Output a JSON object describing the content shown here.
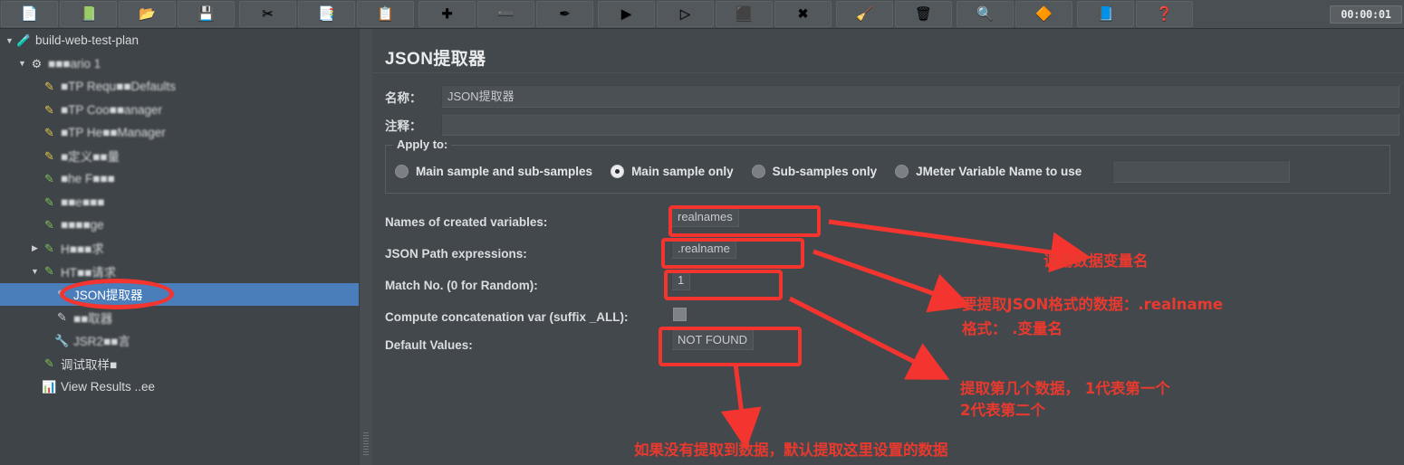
{
  "toolbar": {
    "buttons": [
      {
        "name": "new",
        "glyph": "📄"
      },
      {
        "name": "templates",
        "glyph": "📗"
      },
      {
        "name": "open",
        "glyph": "📂"
      },
      {
        "name": "save",
        "glyph": "💾"
      },
      {
        "name": "cut",
        "glyph": "✂"
      },
      {
        "name": "copy",
        "glyph": "📑"
      },
      {
        "name": "paste",
        "glyph": "📋"
      },
      {
        "name": "expand-all",
        "glyph": "✚"
      },
      {
        "name": "collapse-all",
        "glyph": "➖"
      },
      {
        "name": "toggle",
        "glyph": "✒"
      },
      {
        "name": "start",
        "glyph": "▶"
      },
      {
        "name": "start-no-timers",
        "glyph": "▷"
      },
      {
        "name": "stop",
        "glyph": "⬛"
      },
      {
        "name": "shutdown",
        "glyph": "✖"
      },
      {
        "name": "clear",
        "glyph": "🧹"
      },
      {
        "name": "clear-all",
        "glyph": "🗑"
      },
      {
        "name": "search",
        "glyph": "🔍"
      },
      {
        "name": "search-reset",
        "glyph": "🔶"
      },
      {
        "name": "function-helper",
        "glyph": "📘"
      },
      {
        "name": "help",
        "glyph": "❓"
      }
    ],
    "clock": "00:00:01"
  },
  "tree": {
    "items": [
      {
        "label": "build-web-test-plan",
        "indent": 0,
        "toggle": "▼",
        "icon": "🧪",
        "icon_color": "#5aa6e8",
        "selected": false,
        "blur": false
      },
      {
        "label": "■■■ario 1",
        "indent": 1,
        "toggle": "▼",
        "icon": "⚙",
        "icon_color": "#d8dbdd",
        "selected": false,
        "blur": true
      },
      {
        "label": "■TP Requ■■Defaults",
        "indent": 2,
        "toggle": "",
        "icon": "✎",
        "icon_color": "#e0c84a",
        "selected": false,
        "blur": true
      },
      {
        "label": "■TP Coo■■anager",
        "indent": 2,
        "toggle": "",
        "icon": "✎",
        "icon_color": "#e0c84a",
        "selected": false,
        "blur": true
      },
      {
        "label": "■TP He■■Manager",
        "indent": 2,
        "toggle": "",
        "icon": "✎",
        "icon_color": "#e0c84a",
        "selected": false,
        "blur": true
      },
      {
        "label": "■定义■■量",
        "indent": 2,
        "toggle": "",
        "icon": "✎",
        "icon_color": "#e0c84a",
        "selected": false,
        "blur": true
      },
      {
        "label": "■he F■■■",
        "indent": 2,
        "toggle": "",
        "icon": "✎",
        "icon_color": "#7dc15a",
        "selected": false,
        "blur": true
      },
      {
        "label": "■■e■■■",
        "indent": 2,
        "toggle": "",
        "icon": "✎",
        "icon_color": "#7dc15a",
        "selected": false,
        "blur": true
      },
      {
        "label": "■■■■ge",
        "indent": 2,
        "toggle": "",
        "icon": "✎",
        "icon_color": "#7dc15a",
        "selected": false,
        "blur": true
      },
      {
        "label": "H■■■求",
        "indent": 2,
        "toggle": "▶",
        "icon": "✎",
        "icon_color": "#7dc15a",
        "selected": false,
        "blur": true
      },
      {
        "label": "HT■■请求",
        "indent": 2,
        "toggle": "▼",
        "icon": "✎",
        "icon_color": "#7dc15a",
        "selected": false,
        "blur": true
      },
      {
        "label": "JSON提取器",
        "indent": 3,
        "toggle": "",
        "icon": "✎",
        "icon_color": "#c9ccd0",
        "selected": true,
        "blur": false
      },
      {
        "label": "■■取器",
        "indent": 3,
        "toggle": "",
        "icon": "✎",
        "icon_color": "#c9ccd0",
        "selected": false,
        "blur": true
      },
      {
        "label": "JSR2■■言",
        "indent": 3,
        "toggle": "",
        "icon": "🔧",
        "icon_color": "#9fc9e8",
        "selected": false,
        "blur": true
      },
      {
        "label": "调试取样■",
        "indent": 2,
        "toggle": "",
        "icon": "✎",
        "icon_color": "#7dc15a",
        "selected": false,
        "blur": false
      },
      {
        "label": "View Results ..ee",
        "indent": 2,
        "toggle": "",
        "icon": "📊",
        "icon_color": "#e89ac4",
        "selected": false,
        "blur": false
      }
    ]
  },
  "panel": {
    "title": "JSON提取器",
    "name_label": "名称：",
    "name_value": "JSON提取器",
    "comment_label": "注释：",
    "comment_value": "",
    "apply_to_title": "Apply to:",
    "radios": [
      {
        "label": "Main sample and sub-samples",
        "selected": false
      },
      {
        "label": "Main sample only",
        "selected": true
      },
      {
        "label": "Sub-samples only",
        "selected": false
      },
      {
        "label": "JMeter Variable Name to use",
        "selected": false
      }
    ],
    "jmeter_variable_value": "",
    "fields": [
      {
        "label": "Names of created variables:",
        "value": "realnames",
        "type": "text"
      },
      {
        "label": "JSON Path expressions:",
        "value": ".realname",
        "type": "text"
      },
      {
        "label": "Match No. (0 for Random):",
        "value": "1",
        "type": "text"
      },
      {
        "label": "Compute concatenation var (suffix _ALL):",
        "value": "",
        "type": "checkbox"
      },
      {
        "label": "Default Values:",
        "value": "NOT FOUND",
        "type": "text"
      }
    ]
  },
  "annotations": {
    "color": "#e8392f",
    "notes": [
      {
        "id": "n1",
        "text": "调用数据变量名"
      },
      {
        "id": "n2",
        "text": "要提取JSON格式的数据：.realname"
      },
      {
        "id": "n3",
        "text": "格式： .变量名"
      },
      {
        "id": "n4",
        "text": "提取第几个数据， 1代表第一个"
      },
      {
        "id": "n5",
        "text": "2代表第二个"
      },
      {
        "id": "n6",
        "text": "如果没有提取到数据，默认提取这里设置的数据"
      }
    ]
  }
}
